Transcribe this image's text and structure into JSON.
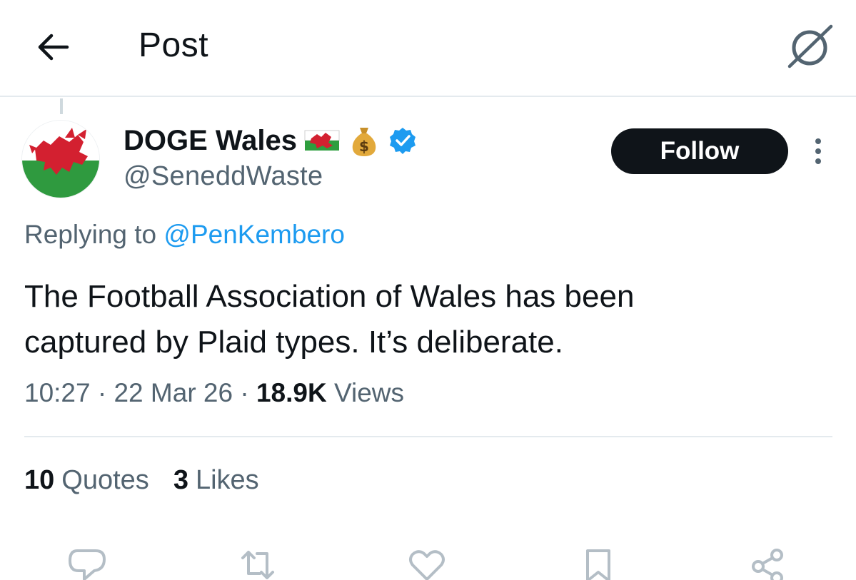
{
  "header": {
    "title": "Post",
    "back_icon": "arrow-left-icon",
    "grok_icon": "grok-icon"
  },
  "author": {
    "display_name": "DOGE Wales",
    "handle": "@SeneddWaste",
    "verified": true,
    "emojis": [
      "welsh-flag-emoji",
      "money-bag-emoji"
    ],
    "avatar": "welsh-dragon-flag-avatar"
  },
  "follow_label": "Follow",
  "reply": {
    "prefix": "Replying to",
    "mention": "@PenKembero"
  },
  "tweet": {
    "line1": "The Football Association of Wales has been",
    "line2": "captured by Plaid types. It’s deliberate."
  },
  "meta": {
    "time": "10:27",
    "separator": "·",
    "date": "22 Mar 26",
    "views_count": "18.9K",
    "views_label": "Views"
  },
  "stats": {
    "quotes_count": "10",
    "quotes_label": "Quotes",
    "likes_count": "3",
    "likes_label": "Likes"
  },
  "actions": [
    "reply-icon",
    "repost-icon",
    "like-icon",
    "bookmark-icon",
    "share-icon"
  ],
  "colors": {
    "link": "#1d9bf0",
    "muted": "#536471",
    "text": "#0f1419",
    "follow_bg": "#0f1419"
  }
}
